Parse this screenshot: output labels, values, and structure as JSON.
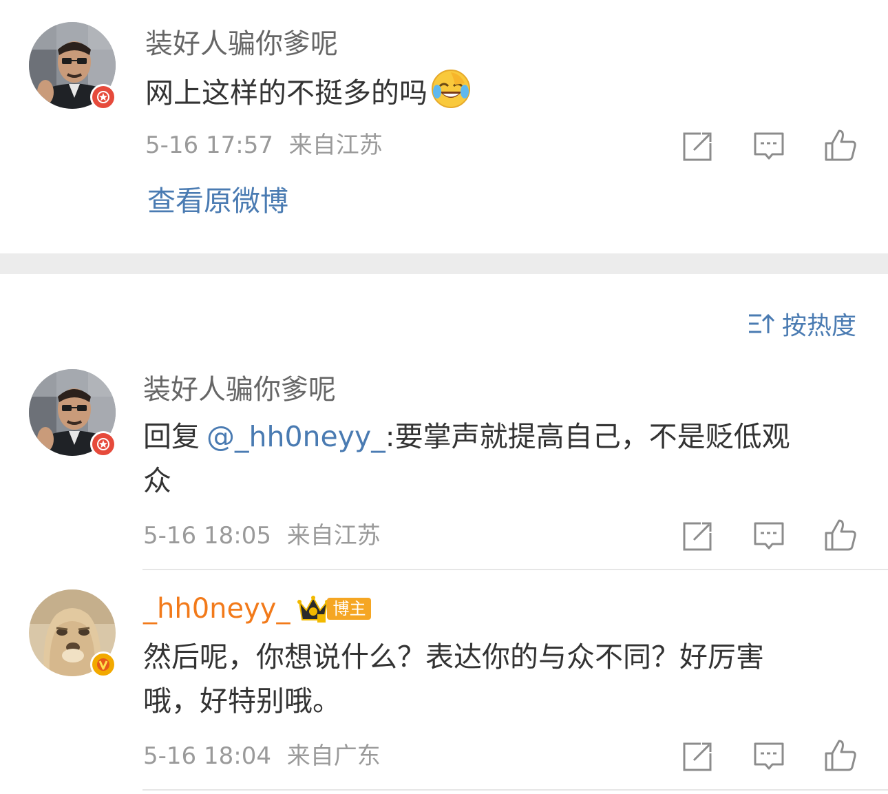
{
  "post": {
    "username": "装好人骗你爹呢",
    "text": "网上这样的不挺多的吗",
    "time": "5-16 17:57",
    "location": "来自江苏",
    "view_original": "查看原微博",
    "emoji": "laugh-cry-emoji"
  },
  "sort": {
    "label": "按热度",
    "icon": "sort-icon"
  },
  "comments": [
    {
      "username": "装好人骗你爹呢",
      "reply_prefix": "回复",
      "mention": "@_hh0neyy_",
      "text_lines": [
        ":要掌声就提高自己，不是贬低观",
        "众"
      ],
      "time": "5-16 18:05",
      "location": "来自江苏"
    },
    {
      "username": "_hh0neyy_",
      "tag": "博主",
      "text_lines": [
        "然后呢，你想说什么？表达你的与众不同？好厉害",
        "哦，好特别哦。"
      ],
      "time": "5-16 18:04",
      "location": "来自广东"
    }
  ],
  "colors": {
    "link": "#4a7bb2",
    "meta": "#9a9a9a",
    "username": "#666666",
    "badge_red": "#e64a3b",
    "badge_gold": "#f2a900",
    "username_orange": "#f27a1a"
  }
}
